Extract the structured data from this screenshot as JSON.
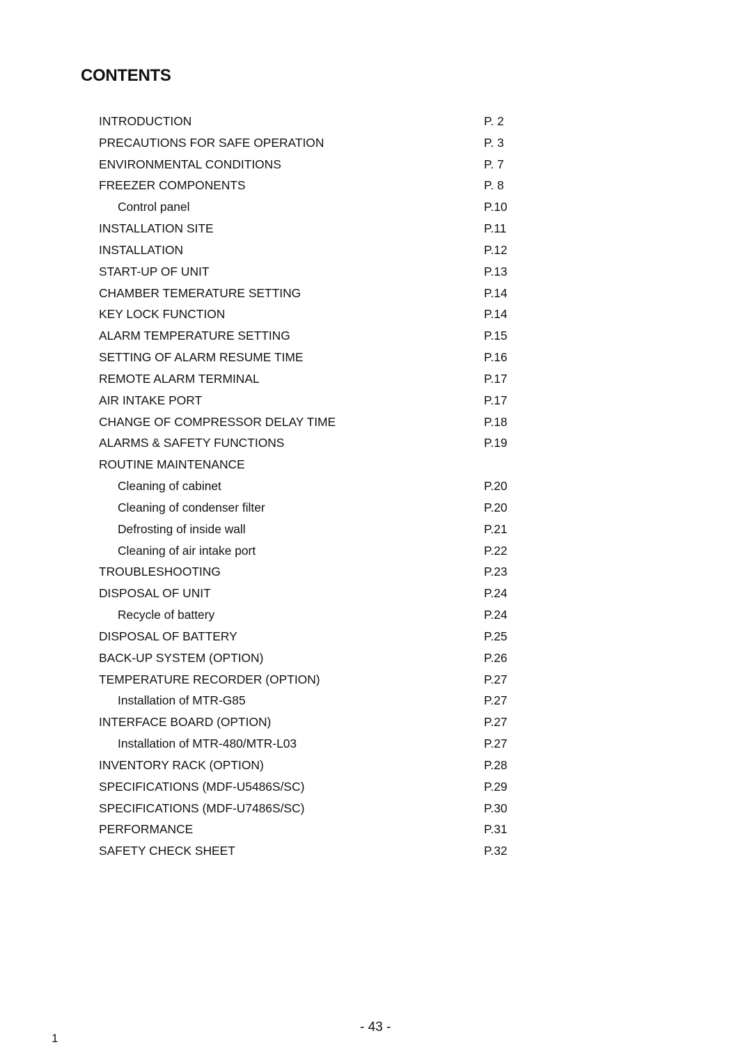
{
  "document": {
    "title": "CONTENTS",
    "entries": [
      {
        "label": "INTRODUCTION",
        "page": "P. 2",
        "level": 1
      },
      {
        "label": "PRECAUTIONS FOR SAFE OPERATION",
        "page": "P. 3",
        "level": 1
      },
      {
        "label": "ENVIRONMENTAL CONDITIONS",
        "page": "P. 7",
        "level": 1
      },
      {
        "label": "FREEZER COMPONENTS",
        "page": "P. 8",
        "level": 1
      },
      {
        "label": "Control panel",
        "page": "P.10",
        "level": 2
      },
      {
        "label": "INSTALLATION SITE",
        "page": "P.11",
        "level": 1
      },
      {
        "label": "INSTALLATION",
        "page": "P.12",
        "level": 1
      },
      {
        "label": "START-UP OF UNIT",
        "page": "P.13",
        "level": 1
      },
      {
        "label": "CHAMBER TEMERATURE SETTING",
        "page": "P.14",
        "level": 1
      },
      {
        "label": "KEY LOCK FUNCTION",
        "page": "P.14",
        "level": 1
      },
      {
        "label": "ALARM TEMPERATURE SETTING",
        "page": "P.15",
        "level": 1
      },
      {
        "label": "SETTING OF ALARM RESUME TIME",
        "page": "P.16",
        "level": 1
      },
      {
        "label": "REMOTE ALARM TERMINAL",
        "page": "P.17",
        "level": 1
      },
      {
        "label": "AIR INTAKE PORT",
        "page": "P.17",
        "level": 1
      },
      {
        "label": "CHANGE OF COMPRESSOR DELAY TIME",
        "page": "P.18",
        "level": 1
      },
      {
        "label": "ALARMS & SAFETY FUNCTIONS",
        "page": "P.19",
        "level": 1
      },
      {
        "label": "ROUTINE MAINTENANCE",
        "page": "",
        "level": 1
      },
      {
        "label": "Cleaning of cabinet",
        "page": "P.20",
        "level": 2
      },
      {
        "label": "Cleaning of condenser filter",
        "page": "P.20",
        "level": 2
      },
      {
        "label": "Defrosting of inside wall",
        "page": "P.21",
        "level": 2
      },
      {
        "label": "Cleaning of air intake port",
        "page": "P.22",
        "level": 2
      },
      {
        "label": "TROUBLESHOOTING",
        "page": "P.23",
        "level": 1
      },
      {
        "label": "DISPOSAL OF UNIT",
        "page": "P.24",
        "level": 1
      },
      {
        "label": "Recycle of battery",
        "page": "P.24",
        "level": 2
      },
      {
        "label": "DISPOSAL OF BATTERY",
        "page": "P.25",
        "level": 1
      },
      {
        "label": "BACK-UP SYSTEM (OPTION)",
        "page": "P.26",
        "level": 1
      },
      {
        "label": "TEMPERATURE RECORDER (OPTION)",
        "page": "P.27",
        "level": 1
      },
      {
        "label": "Installation of MTR-G85",
        "page": "P.27",
        "level": 2
      },
      {
        "label": "INTERFACE BOARD (OPTION)",
        "page": "P.27",
        "level": 1
      },
      {
        "label": "Installation of MTR-480/MTR-L03",
        "page": "P.27",
        "level": 2
      },
      {
        "label": "INVENTORY RACK (OPTION)",
        "page": "P.28",
        "level": 1
      },
      {
        "label": "SPECIFICATIONS (MDF-U5486S/SC)",
        "page": "P.29",
        "level": 1
      },
      {
        "label": "SPECIFICATIONS (MDF-U7486S/SC)",
        "page": "P.30",
        "level": 1
      },
      {
        "label": "PERFORMANCE",
        "page": "P.31",
        "level": 1
      },
      {
        "label": "SAFETY CHECK SHEET",
        "page": "P.32",
        "level": 1
      }
    ],
    "footer": {
      "page_number": "- 43 -",
      "side_number": "1"
    }
  }
}
